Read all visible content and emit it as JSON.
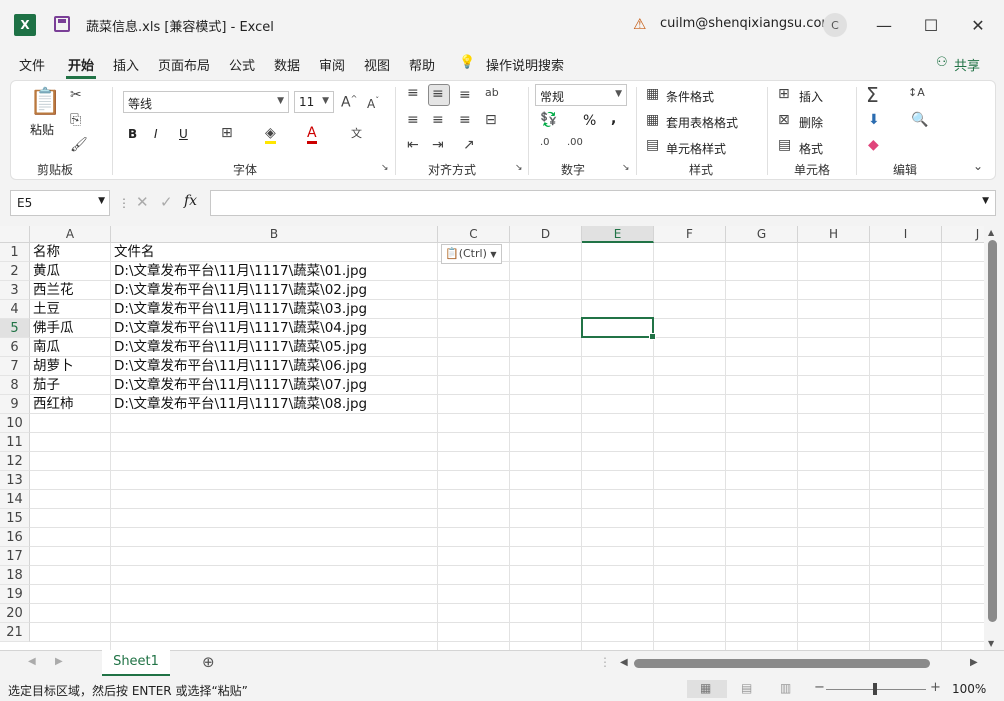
{
  "titlebar": {
    "app_icon": "X",
    "title": "蔬菜信息.xls  [兼容模式]  -  Excel",
    "user": "cuilm@shenqixiangsu.com",
    "avatar": "C",
    "icons": [
      "excel-icon",
      "save-icon",
      "warning-icon",
      "minimize-icon",
      "maximize-icon",
      "close-icon"
    ]
  },
  "menu": {
    "items": [
      "文件",
      "开始",
      "插入",
      "页面布局",
      "公式",
      "数据",
      "审阅",
      "视图",
      "帮助"
    ],
    "active": "开始",
    "search": "操作说明搜索",
    "share": "共享"
  },
  "ribbon": {
    "clipboard": {
      "paste": "粘贴",
      "label": "剪贴板"
    },
    "font": {
      "name": "等线",
      "size": "11",
      "label": "字体",
      "bold": "B",
      "italic": "I",
      "underline": "U"
    },
    "alignment": {
      "label": "对齐方式"
    },
    "number": {
      "format": "常规",
      "label": "数字",
      "percent": "%",
      "comma": ","
    },
    "styles": {
      "conditional": "条件格式",
      "table": "套用表格格式",
      "cell": "单元格样式",
      "label": "样式"
    },
    "cells": {
      "insert": "插入",
      "delete": "删除",
      "format": "格式",
      "label": "单元格"
    },
    "editing": {
      "label": "编辑"
    }
  },
  "formulabar": {
    "namebox": "E5",
    "fx": "fx",
    "value": ""
  },
  "grid": {
    "columns": [
      "A",
      "B",
      "C",
      "D",
      "E",
      "F",
      "G",
      "H",
      "I",
      "J"
    ],
    "selected_column": "E",
    "rows": [
      "1",
      "2",
      "3",
      "4",
      "5",
      "6",
      "7",
      "8",
      "9",
      "10",
      "11",
      "12",
      "13",
      "14",
      "15",
      "16",
      "17",
      "18",
      "19",
      "20",
      "21"
    ],
    "selected_row": "5",
    "cells": [
      {
        "a": "名称",
        "b": "文件名"
      },
      {
        "a": "黄瓜",
        "b": "D:\\文章发布平台\\11月\\1117\\蔬菜\\01.jpg"
      },
      {
        "a": "西兰花",
        "b": "D:\\文章发布平台\\11月\\1117\\蔬菜\\02.jpg"
      },
      {
        "a": "土豆",
        "b": "D:\\文章发布平台\\11月\\1117\\蔬菜\\03.jpg"
      },
      {
        "a": "佛手瓜",
        "b": "D:\\文章发布平台\\11月\\1117\\蔬菜\\04.jpg"
      },
      {
        "a": "南瓜",
        "b": "D:\\文章发布平台\\11月\\1117\\蔬菜\\05.jpg"
      },
      {
        "a": "胡萝卜",
        "b": "D:\\文章发布平台\\11月\\1117\\蔬菜\\06.jpg"
      },
      {
        "a": "茄子",
        "b": "D:\\文章发布平台\\11月\\1117\\蔬菜\\07.jpg"
      },
      {
        "a": "西红柿",
        "b": "D:\\文章发布平台\\11月\\1117\\蔬菜\\08.jpg"
      }
    ],
    "paste_options": "(Ctrl)"
  },
  "sheets": {
    "tabs": [
      "Sheet1"
    ],
    "add": "⊕"
  },
  "status": {
    "text": "选定目标区域，然后按 ENTER 或选择“粘贴”",
    "zoom": "100%"
  },
  "colors": {
    "accent": "#217346",
    "excel_green": "#1e7145"
  }
}
